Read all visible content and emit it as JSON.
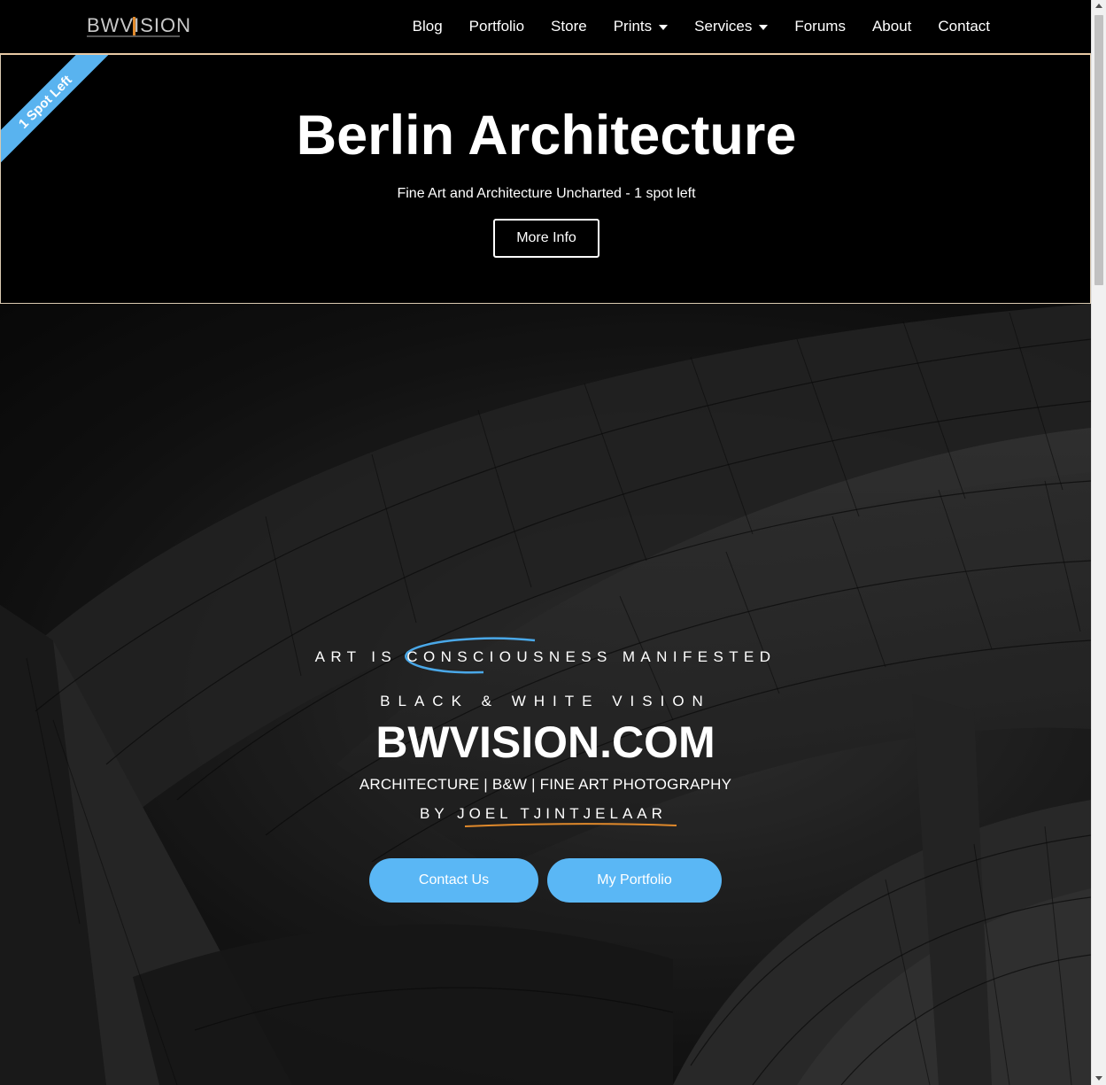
{
  "brand": {
    "logo_text": "BWVISION"
  },
  "nav": {
    "items": [
      {
        "label": "Blog",
        "has_dropdown": false
      },
      {
        "label": "Portfolio",
        "has_dropdown": false
      },
      {
        "label": "Store",
        "has_dropdown": false
      },
      {
        "label": "Prints",
        "has_dropdown": true
      },
      {
        "label": "Services",
        "has_dropdown": true
      },
      {
        "label": "Forums",
        "has_dropdown": false
      },
      {
        "label": "About",
        "has_dropdown": false
      },
      {
        "label": "Contact",
        "has_dropdown": false
      }
    ]
  },
  "promo": {
    "ribbon": "1 Spot Left",
    "title": "Berlin Architecture",
    "subtitle": "Fine Art and Architecture Uncharted - 1 spot left",
    "button": "More Info"
  },
  "hero": {
    "tagline": "ART IS CONSCIOUSNESS MANIFESTED",
    "vision": "BLACK & WHITE VISION",
    "site_title": "BWVISION.COM",
    "categories": "ARCHITECTURE | B&W | FINE ART PHOTOGRAPHY",
    "byline": "BY JOEL TJINTJELAAR",
    "buttons": {
      "contact": "Contact Us",
      "portfolio": "My Portfolio"
    }
  },
  "colors": {
    "accent_blue": "#5ab7f5",
    "ribbon_blue": "#59b3ef",
    "accent_orange": "#e0892b",
    "promo_border": "#d9c9b0"
  },
  "icons": [
    "caret-down-icon",
    "scroll-up-arrow-icon",
    "scroll-down-arrow-icon"
  ]
}
